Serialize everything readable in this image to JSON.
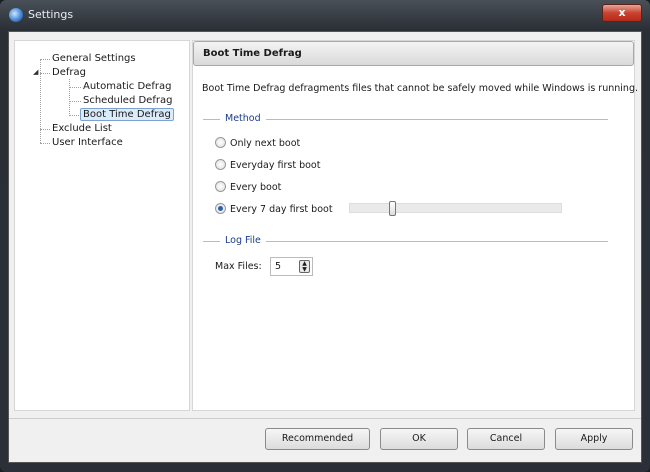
{
  "window": {
    "title": "Settings",
    "close_label": "x"
  },
  "tree": {
    "general": "General Settings",
    "defrag": "Defrag",
    "automatic": "Automatic Defrag",
    "scheduled": "Scheduled Defrag",
    "boot_time": "Boot Time Defrag",
    "exclude": "Exclude List",
    "ui": "User Interface"
  },
  "panel": {
    "header": "Boot Time Defrag",
    "description": "Boot Time Defrag defragments files that cannot be safely moved while Windows is running.",
    "method_label": "Method",
    "options": [
      "Only next boot",
      "Everyday first boot",
      "Every boot",
      "Every 7 day first boot"
    ],
    "selected_option": 3,
    "day_slider_fraction": 0.19,
    "log_label": "Log File",
    "max_files_label": "Max Files:",
    "max_files_value": "5"
  },
  "buttons": {
    "recommended": "Recommended",
    "ok": "OK",
    "cancel": "Cancel",
    "apply": "Apply"
  }
}
